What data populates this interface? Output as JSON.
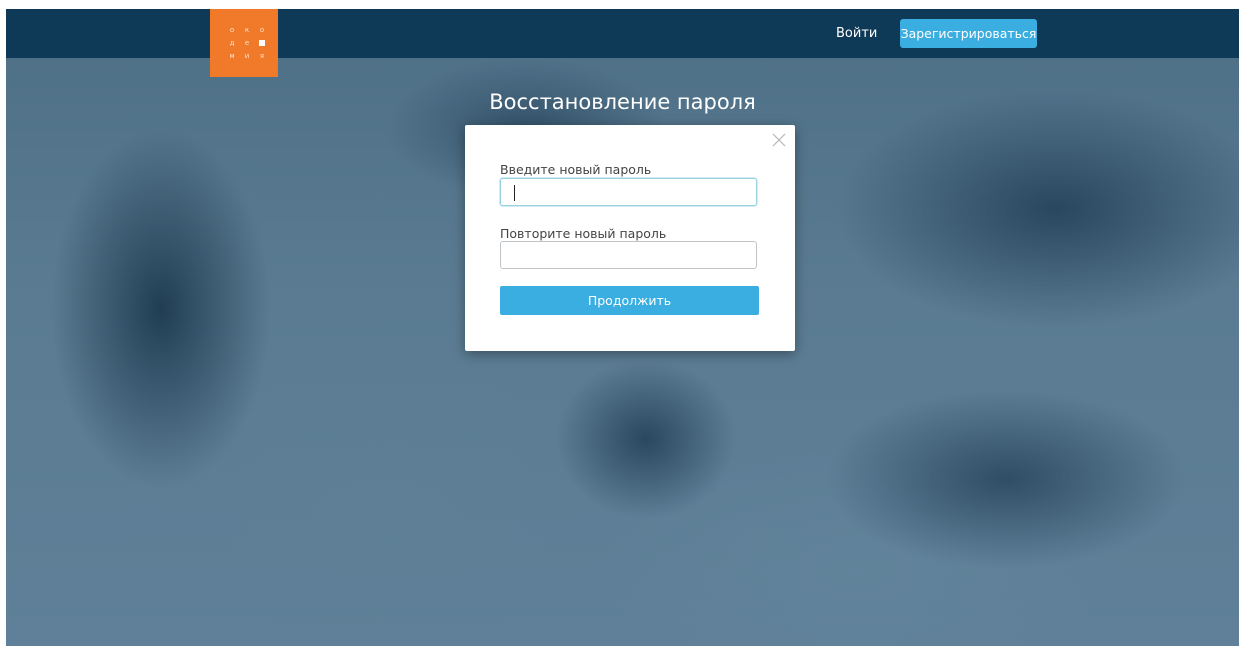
{
  "header": {
    "logo": {
      "row1": [
        "о",
        "к",
        "о"
      ],
      "row2": [
        "д",
        "е"
      ],
      "row3": [
        "м",
        "и",
        "я"
      ],
      "brand_color": "#f0792a"
    },
    "login_label": "Войти",
    "register_label": "Зарегистрироваться"
  },
  "page_title": "Восстановление пароля",
  "modal": {
    "close_icon": "close-icon",
    "new_password_label": "Введите новый пароль",
    "new_password_value": "",
    "repeat_password_label": "Повторите новый пароль",
    "repeat_password_value": "",
    "continue_label": "Продолжить"
  },
  "colors": {
    "topbar": "#0f3a57",
    "accent": "#3aaee0",
    "background": "#587a90"
  }
}
